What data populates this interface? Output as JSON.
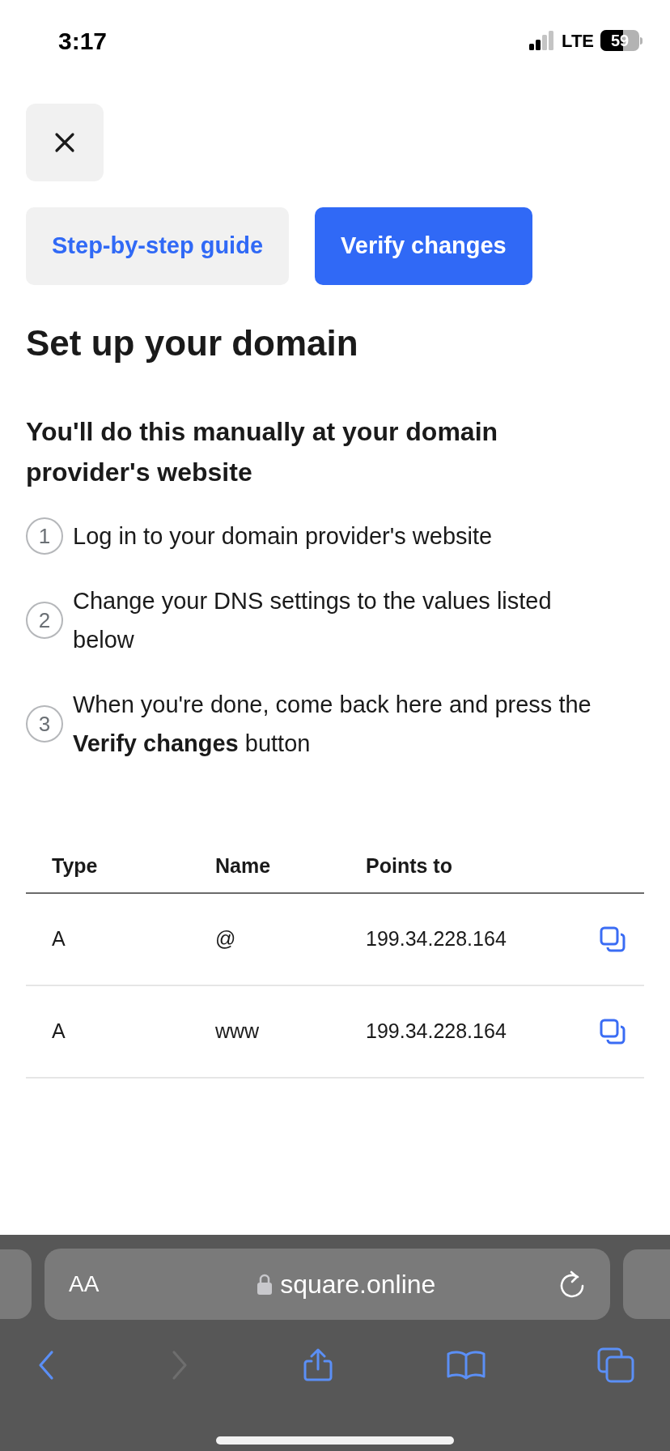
{
  "status_bar": {
    "time": "3:17",
    "network": "LTE",
    "battery": "59"
  },
  "buttons": [
    {
      "label": "Step-by-step guide",
      "kind": "secondary"
    },
    {
      "label": "Verify changes",
      "kind": "primary"
    }
  ],
  "title": "Set up your domain",
  "subtitle": "You'll do this manually at your domain provider's website",
  "steps": [
    {
      "number": "1",
      "text": "Log in to your domain provider's website"
    },
    {
      "number": "2",
      "text": "Change your DNS settings to the values listed below"
    },
    {
      "number": "3",
      "text": "When you're done, come back here and press the **Verify changes** button"
    }
  ],
  "table": {
    "columns": [
      "Type",
      "Name",
      "Points to"
    ],
    "rows": [
      {
        "type": "A",
        "name": "@",
        "points_to": "199.34.228.164"
      },
      {
        "type": "A",
        "name": "www",
        "points_to": "199.34.228.164"
      }
    ]
  },
  "browser": {
    "text_size": "AA",
    "url": "square.online",
    "toolbar": [
      {
        "kind": "back",
        "disabled": false
      },
      {
        "kind": "forward",
        "disabled": true
      },
      {
        "kind": "share",
        "disabled": false
      },
      {
        "kind": "bookmarks",
        "disabled": false
      },
      {
        "kind": "tabs",
        "disabled": false
      }
    ]
  }
}
